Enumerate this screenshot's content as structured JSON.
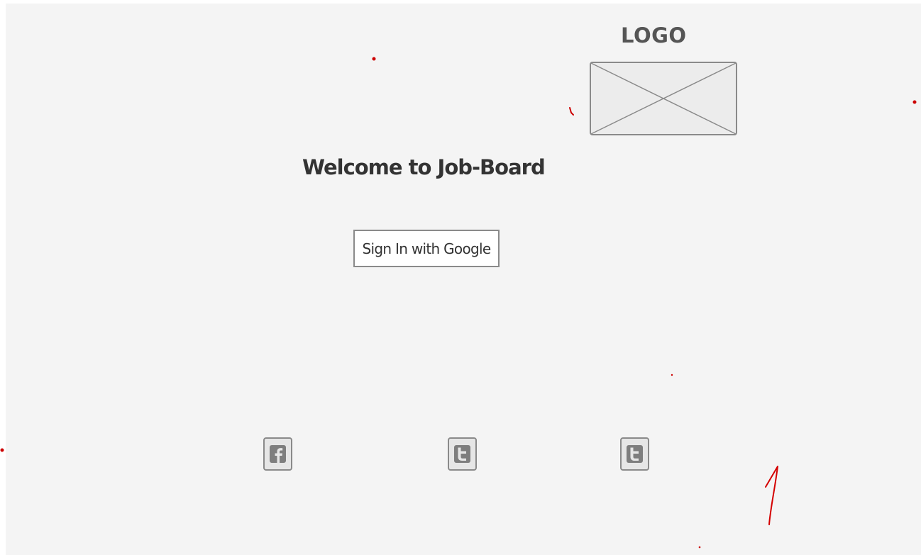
{
  "header": {
    "logo_label": "LOGO"
  },
  "main": {
    "welcome_title": "Welcome to Job-Board",
    "sign_in_button_label": "Sign In with Google"
  },
  "footer": {
    "social_links": [
      {
        "icon": "facebook-icon"
      },
      {
        "icon": "twitter-icon"
      },
      {
        "icon": "twitter-icon"
      }
    ]
  },
  "colors": {
    "background": "#f4f4f4",
    "wireframe_gray": "#8a8a8a",
    "text_dark": "#333333",
    "annotation_red": "#cc0000"
  }
}
